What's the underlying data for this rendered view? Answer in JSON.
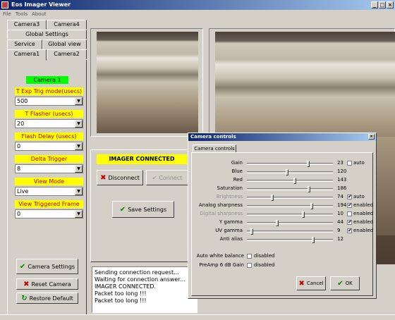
{
  "window": {
    "title": "Eos Imager Viewer"
  },
  "menu": [
    "File",
    "Tools",
    "About"
  ],
  "tabs": {
    "row1": [
      "Camera3",
      "Camera4"
    ],
    "row2": [
      "Global Settings"
    ],
    "row3": [
      "Service",
      "Global view"
    ],
    "row4": [
      "Camera1",
      "Camera2"
    ]
  },
  "camera_title": "Camera 1",
  "fields": [
    {
      "label": "T Exp Trig mode(usecs)",
      "value": "500"
    },
    {
      "label": "T Flasher (usecs)",
      "value": "20"
    },
    {
      "label": "Flash Delay (usecs)",
      "value": "0"
    },
    {
      "label": "Delta Trigger",
      "value": "8"
    },
    {
      "label": "View Mode",
      "value": "Live"
    },
    {
      "label": "View Triggered Frame",
      "value": "0"
    }
  ],
  "buttons": {
    "camera_settings": "Camera Settings",
    "reset_camera": "Reset Camera",
    "restore_default": "Restore Default",
    "disconnect": "Disconnect",
    "connect": "Connect",
    "save_settings": "Save Settings"
  },
  "status": "IMAGER CONNECTED",
  "log": [
    "Sending connection request...",
    "Waiting for connection answer...",
    "IMAGER CONNECTED.",
    "Packet too long !!!",
    "Packet too long !!!"
  ],
  "dialog": {
    "title": "Camera controls",
    "tab": "Camera controls",
    "controls": [
      {
        "label": "Gain",
        "value": "23",
        "pos": 0.72,
        "check": "auto",
        "checked": false,
        "disabled": false
      },
      {
        "label": "Blue",
        "value": "120",
        "pos": 0.47,
        "check": "",
        "checked": false,
        "disabled": false
      },
      {
        "label": "Red",
        "value": "143",
        "pos": 0.56,
        "check": "",
        "checked": false,
        "disabled": false
      },
      {
        "label": "Saturation",
        "value": "186",
        "pos": 0.73,
        "check": "",
        "checked": false,
        "disabled": false
      },
      {
        "label": "Brightness",
        "value": "74",
        "pos": 0.29,
        "check": "auto",
        "checked": true,
        "disabled": true
      },
      {
        "label": "Analog sharpness",
        "value": "194",
        "pos": 0.76,
        "check": "enabled",
        "checked": true,
        "disabled": false
      },
      {
        "label": "Digital sharpness",
        "value": "10",
        "pos": 0.66,
        "check": "enabled",
        "checked": false,
        "disabled": true
      },
      {
        "label": "Y gamma",
        "value": "44",
        "pos": 0.35,
        "check": "enabled",
        "checked": true,
        "disabled": false
      },
      {
        "label": "UV gamma",
        "value": "9",
        "pos": 0.04,
        "check": "enabled",
        "checked": true,
        "disabled": false
      },
      {
        "label": "Anti alias",
        "value": "12",
        "pos": 0.78,
        "check": "",
        "checked": false,
        "disabled": false
      }
    ],
    "toggles": [
      {
        "label": "Auto white balance",
        "value": "disabled"
      },
      {
        "label": "PreAmp 6 dB Gain",
        "value": "disabled"
      }
    ],
    "cancel": "Cancel",
    "ok": "OK"
  },
  "colors": {
    "title_start": "#0a246a",
    "title_end": "#a6caf0",
    "status_bg": "#ffff00",
    "camera_title_bg": "#00ff00"
  }
}
